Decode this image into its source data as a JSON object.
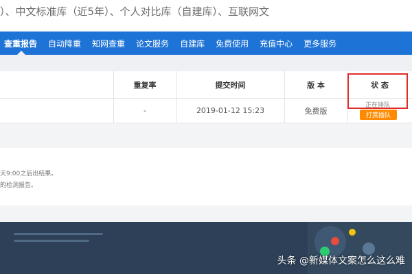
{
  "intro": {
    "text": "）、中文标准库（近5年）、个人对比库（自建库）、互联网文"
  },
  "nav": {
    "items": [
      {
        "label": "查重报告",
        "active": true
      },
      {
        "label": "自动降重"
      },
      {
        "label": "知网查重"
      },
      {
        "label": "论文服务"
      },
      {
        "label": "自建库"
      },
      {
        "label": "免费使用"
      },
      {
        "label": "充值中心"
      },
      {
        "label": "更多服务"
      }
    ]
  },
  "table": {
    "headers": {
      "duplicate_rate": "重复率",
      "submit_time": "提交时间",
      "version": "版 本",
      "status": "状 态"
    },
    "row": {
      "duplicate_rate": "-",
      "submit_time": "2019-01-12 15:23",
      "version": "免费版",
      "status": "正在排队",
      "action": "打赏插队"
    }
  },
  "notice": {
    "line1": "天9:00之后出结果。",
    "line2": "的检测报告。"
  },
  "watermark": "头条 @新媒体文案怎么这么难",
  "colors": {
    "nav_bg": "#1e73d6",
    "highlight_border": "#e02b2b",
    "action_button": "#ff8a00"
  }
}
